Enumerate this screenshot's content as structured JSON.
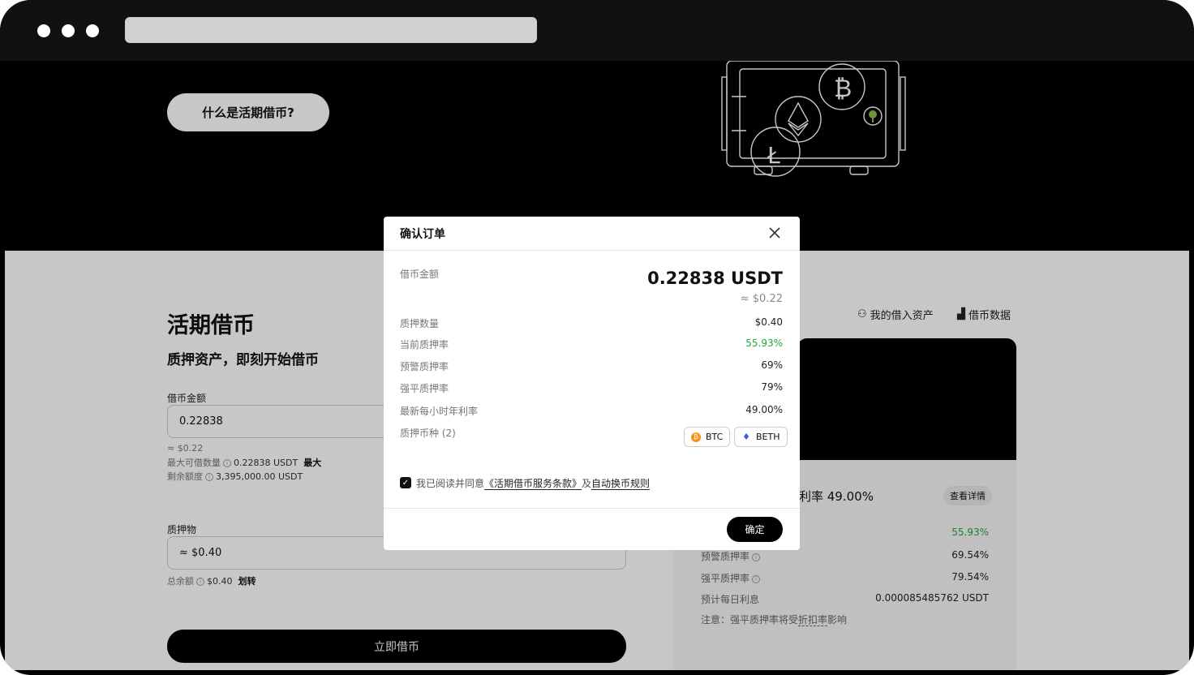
{
  "browser": {
    "url": ""
  },
  "hero": {
    "what_button": "什么是活期借币?"
  },
  "page": {
    "title": "活期借币",
    "subtitle": "质押资产，即刻开始借币",
    "borrow_label": "借币金额",
    "borrow_value": "0.22838",
    "borrow_approx": "≈ $0.22",
    "max_borrow_label": "最大可借数量",
    "max_borrow_value": "0.22838 USDT",
    "max_label": "最大",
    "remaining_label": "剩余额度",
    "remaining_value": "3,395,000.00 USDT",
    "collateral_label": "质押物",
    "collateral_value": "≈ $0.40",
    "balance_label": "总余额",
    "balance_value": "$0.40",
    "transfer_label": "划转",
    "borrow_button": "立即借币"
  },
  "right": {
    "my_assets": "我的借入资产",
    "borrow_data": "借币数据",
    "rate_text": "利率 49.00%",
    "detail_button": "查看详情",
    "rows": [
      {
        "label": "",
        "value": "55.93%"
      },
      {
        "label": "预警质押率",
        "value": "69.54%"
      },
      {
        "label": "强平质押率",
        "value": "79.54%"
      },
      {
        "label": "预计每日利息",
        "value": "0.000085485762 USDT"
      }
    ],
    "note_prefix": "注意：强平质押率将受",
    "note_link": "折扣率",
    "note_suffix": "影响"
  },
  "modal": {
    "title": "确认订单",
    "amount_label": "借币金额",
    "amount_value": "0.22838 USDT",
    "amount_approx": "≈ $0.22",
    "rows": [
      {
        "label": "质押数量",
        "value": "$0.40"
      },
      {
        "label": "当前质押率",
        "value": "55.93%"
      },
      {
        "label": "预警质押率",
        "value": "69%"
      },
      {
        "label": "强平质押率",
        "value": "79%"
      },
      {
        "label": "最新每小时年利率",
        "value": "49.00%"
      }
    ],
    "coins_label": "质押币种 (2)",
    "coins": [
      "BTC",
      "BETH"
    ],
    "agree_prefix": "我已阅读并同意",
    "terms_link": "《活期借币服务条款》",
    "agree_and": "及",
    "rules_link": "自动换币规则",
    "confirm_button": "确定",
    "colors": {
      "green": "#22a447"
    }
  }
}
